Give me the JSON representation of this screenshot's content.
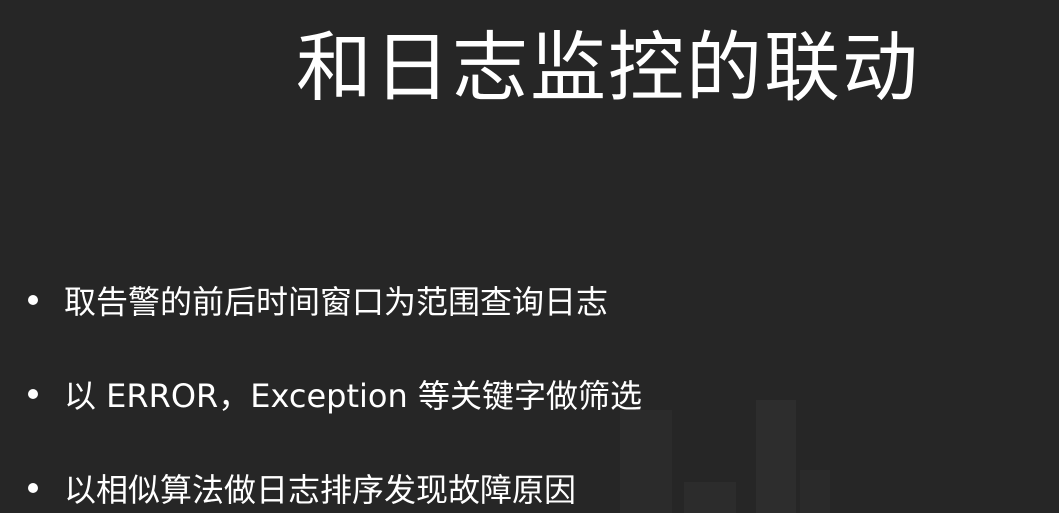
{
  "slide": {
    "title": "和日志监控的联动",
    "bullets": [
      "取告警的前后时间窗口为范围查询日志",
      "以 ERROR，Exception 等关键字做筛选",
      "以相似算法做日志排序发现故障原因"
    ],
    "colors": {
      "background": "#262626",
      "text": "#ffffff"
    }
  }
}
